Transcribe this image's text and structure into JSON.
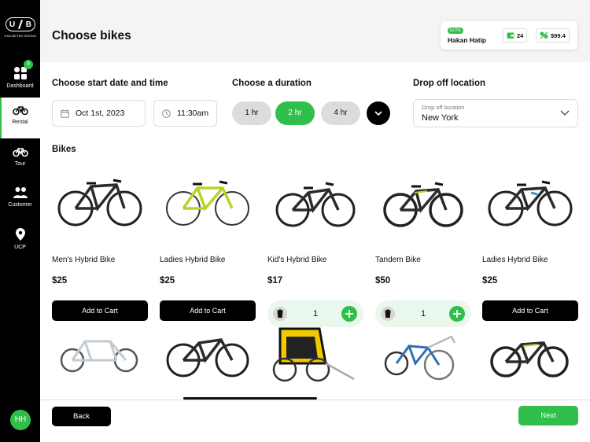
{
  "app": {
    "logo_text": "UNLIMITED BIKING",
    "logo_letters": [
      "U",
      "B"
    ]
  },
  "sidebar": {
    "items": [
      {
        "label": "Dashboard",
        "badge": "9",
        "icon": "dashboard-icon"
      },
      {
        "label": "Rental",
        "icon": "bicycle-icon",
        "active": true
      },
      {
        "label": "Tour",
        "icon": "tandem-icon"
      },
      {
        "label": "Customer",
        "icon": "people-icon"
      },
      {
        "label": "UCP",
        "icon": "location-pin-icon"
      }
    ],
    "avatar_initials": "HH"
  },
  "header": {
    "title": "Choose bikes",
    "user": {
      "tier": "ELITE",
      "name": "Hakan Hatip",
      "stat1": "24",
      "stat2": "$99.4"
    }
  },
  "booking": {
    "start_label": "Choose start date and time",
    "date_value": "Oct 1st, 2023",
    "time_value": "11:30am",
    "duration_label": "Choose a duration",
    "durations": [
      "1 hr",
      "2 hr",
      "4 hr"
    ],
    "selected_duration": "2 hr",
    "dropoff_label": "Drop off location",
    "dropoff_field_label": "Drop off location",
    "dropoff_value": "New York"
  },
  "bikes_label": "Bikes",
  "products": [
    {
      "name": "Men's Hybrid Bike",
      "price": "$25",
      "action": "Add to Cart",
      "in_cart": false
    },
    {
      "name": "Ladies Hybrid Bike",
      "price": "$25",
      "action": "Add to Cart",
      "in_cart": false
    },
    {
      "name": "Kid's Hybrid Bike",
      "price": "$17",
      "qty": "1",
      "in_cart": true
    },
    {
      "name": "Tandem Bike",
      "price": "$50",
      "qty": "1",
      "in_cart": true
    },
    {
      "name": "Ladies Hybrid Bike",
      "price": "$25",
      "action": "Add to Cart",
      "in_cart": false
    }
  ],
  "footer": {
    "back_label": "Back",
    "next_label": "Next"
  },
  "colors": {
    "accent": "#2fbf4a",
    "sidebar_bg": "#000000",
    "header_bg": "#f4f4f4"
  }
}
